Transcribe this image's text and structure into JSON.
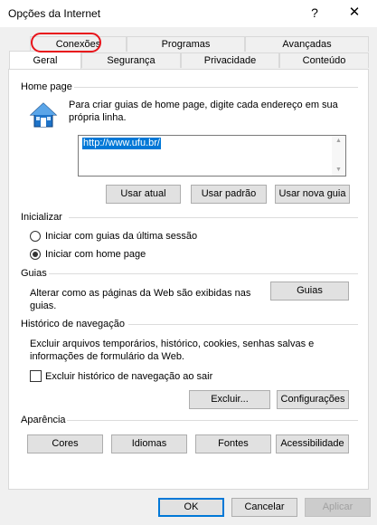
{
  "window": {
    "title": "Opções da Internet",
    "help_glyph": "?",
    "close_glyph": "✕"
  },
  "tabs": {
    "row_back": [
      "Conexões",
      "Programas",
      "Avançadas"
    ],
    "row_front": [
      "Geral",
      "Segurança",
      "Privacidade",
      "Conteúdo"
    ],
    "selected": "Geral",
    "highlighted": "Conexões",
    "highlight_color": "#e8131a"
  },
  "home_page": {
    "section_title": "Home page",
    "description": "Para criar guias de home page, digite cada endereço em sua própria linha.",
    "url_value": "http://www.ufu.br/",
    "buttons": {
      "use_current": "Usar atual",
      "use_default": "Usar padrão",
      "use_new_tab": "Usar nova guia"
    }
  },
  "startup": {
    "section_title": "Inicializar",
    "option_last_session": "Iniciar com guias da última sessão",
    "option_home_page": "Iniciar com home page",
    "selected": "home_page"
  },
  "tabs_section": {
    "section_title": "Guias",
    "description": "Alterar como as páginas da Web são exibidas nas guias.",
    "button": "Guias"
  },
  "history": {
    "section_title": "Histórico de navegação",
    "description": "Excluir arquivos temporários, histórico, cookies, senhas salvas e informações de formulário da Web.",
    "checkbox_label": "Excluir histórico de navegação ao sair",
    "checkbox_checked": false,
    "delete_button": "Excluir...",
    "settings_button": "Configurações"
  },
  "appearance": {
    "section_title": "Aparência",
    "buttons": {
      "colors": "Cores",
      "languages": "Idiomas",
      "fonts": "Fontes",
      "accessibility": "Acessibilidade"
    }
  },
  "footer": {
    "ok": "OK",
    "cancel": "Cancelar",
    "apply": "Aplicar",
    "apply_enabled": false
  },
  "colors": {
    "selection": "#0078d7",
    "icon_house": "#1e73c8"
  }
}
